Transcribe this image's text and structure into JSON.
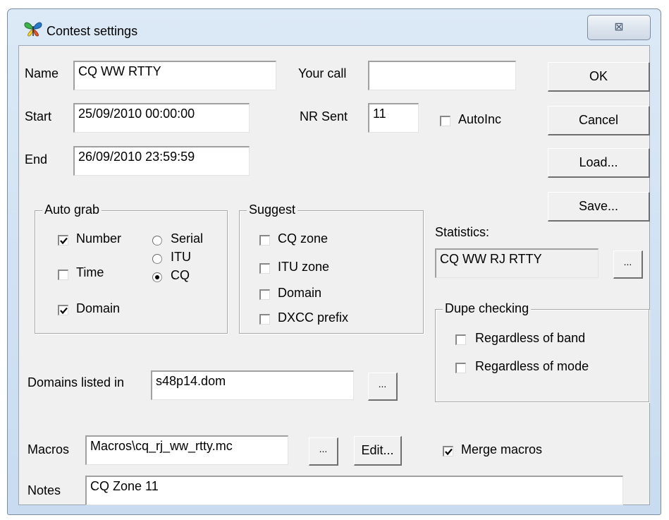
{
  "window": {
    "title": "Contest settings",
    "close_glyph": "⊠"
  },
  "fields": {
    "name_label": "Name",
    "name_value": "CQ WW RTTY",
    "start_label": "Start",
    "start_value": "25/09/2010 00:00:00",
    "end_label": "End",
    "end_value": "26/09/2010 23:59:59",
    "your_call_label": "Your call",
    "your_call_value": "",
    "nr_sent_label": "NR Sent",
    "nr_sent_value": "11",
    "autoinc_label": "AutoInc",
    "autoinc_checked": false
  },
  "buttons": {
    "ok": "OK",
    "cancel": "Cancel",
    "load": "Load...",
    "save": "Save...",
    "browse": "...",
    "edit": "Edit..."
  },
  "auto_grab": {
    "title": "Auto grab",
    "number_label": "Number",
    "number_checked": true,
    "time_label": "Time",
    "time_checked": false,
    "domain_label": "Domain",
    "domain_checked": true,
    "serial_label": "Serial",
    "itu_label": "ITU",
    "cq_label": "CQ",
    "selected_radio": "CQ"
  },
  "suggest": {
    "title": "Suggest",
    "items": [
      {
        "label": "CQ zone",
        "checked": false
      },
      {
        "label": "ITU zone",
        "checked": false
      },
      {
        "label": "Domain",
        "checked": false
      },
      {
        "label": "DXCC prefix",
        "checked": false
      }
    ]
  },
  "statistics": {
    "label": "Statistics:",
    "value": "CQ WW RJ RTTY"
  },
  "dupe_checking": {
    "title": "Dupe checking",
    "band_label": "Regardless of band",
    "band_checked": false,
    "mode_label": "Regardless of mode",
    "mode_checked": false
  },
  "domains": {
    "label": "Domains listed in",
    "value": "s48p14.dom"
  },
  "macros": {
    "label": "Macros",
    "value": "Macros\\cq_rj_ww_rtty.mc",
    "merge_label": "Merge macros",
    "merge_checked": true
  },
  "notes": {
    "label": "Notes",
    "value": "CQ Zone 11"
  },
  "icons": {
    "app": "butterfly-icon",
    "close": "close-icon",
    "check": "check-mark-icon",
    "radio_dot": "radio-dot-icon"
  },
  "colors": {
    "title_bar": "#c9dbef",
    "dialog_face": "#f0f0f0",
    "icon_green": "#3cb34a",
    "icon_blue": "#2a78c8"
  }
}
